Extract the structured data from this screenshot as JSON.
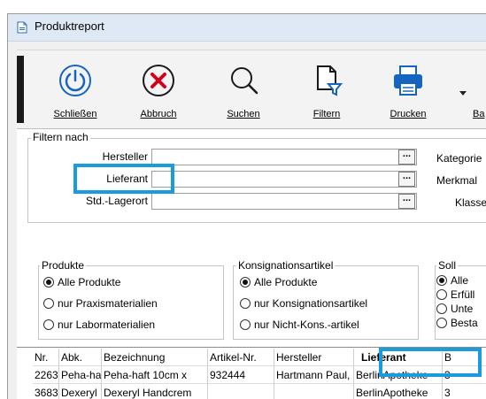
{
  "window": {
    "title": "Produktreport"
  },
  "toolbar": {
    "close_label": "Schließen",
    "cancel_label": "Abbruch",
    "search_label": "Suchen",
    "filter_label": "Filtern",
    "print_label": "Drucken",
    "more_label": "Ba",
    "accent_color": "#1565c0",
    "cancel_color": "#d0021b"
  },
  "filter": {
    "legend": "Filtern nach",
    "hersteller_label": "Hersteller",
    "lieferant_label": "Lieferant",
    "lagerort_label": "Std.-Lagerort",
    "browse_label": "...",
    "kategorie_label": "Kategorie",
    "merkmal_label": "Merkmal",
    "klasse_label": "Klasse"
  },
  "produkte": {
    "legend": "Produkte",
    "options": [
      "Alle Produkte",
      "nur Praxismaterialien",
      "nur Labormaterialien"
    ],
    "selected": "Alle Produkte"
  },
  "konsignation": {
    "legend": "Konsignationsartikel",
    "options": [
      "Alle Produkte",
      "nur Konsignationsartikel",
      "nur Nicht-Kons.-artikel"
    ],
    "selected": "Alle Produkte"
  },
  "soll": {
    "legend": "Soll",
    "options": [
      "Alle",
      "Erfüll",
      "Unte",
      "Besta"
    ],
    "selected": "Alle"
  },
  "table": {
    "headers": [
      "Nr.",
      "Abk.",
      "Bezeichnung",
      "Artikel-Nr.",
      "Hersteller",
      "Lieferant",
      "B"
    ],
    "rows": [
      [
        "2263",
        "Peha-ha",
        "Peha-haft 10cm x",
        "932444",
        "Hartmann Paul,",
        "BerlinApotheke",
        "3"
      ],
      [
        "3683",
        "Dexeryl",
        "Dexeryl Handcrem",
        "",
        "",
        "BerlinApotheke",
        "3"
      ]
    ]
  },
  "highlight_color": "#1a9be0"
}
